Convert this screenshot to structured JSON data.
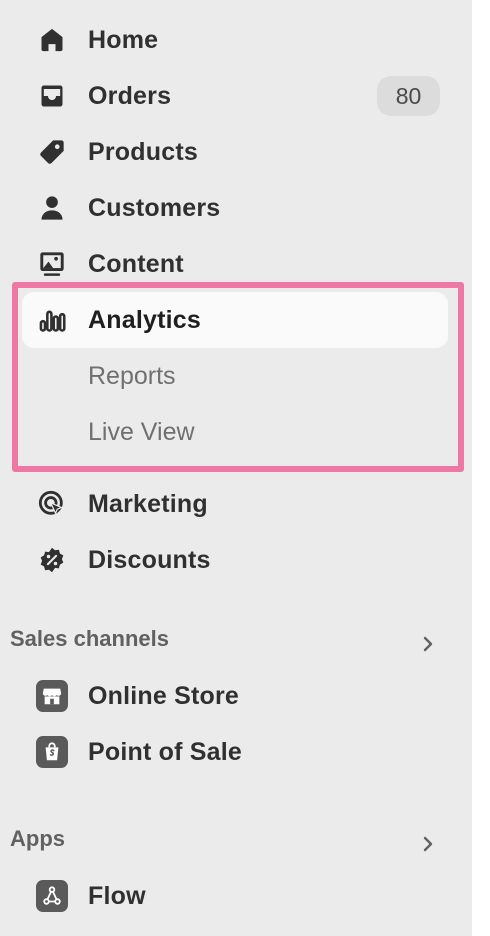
{
  "nav": {
    "home": "Home",
    "orders": "Orders",
    "orders_count": "80",
    "products": "Products",
    "customers": "Customers",
    "content": "Content",
    "analytics": "Analytics",
    "reports": "Reports",
    "live_view": "Live View",
    "marketing": "Marketing",
    "discounts": "Discounts"
  },
  "sales_channels": {
    "title": "Sales channels",
    "items": [
      "Online Store",
      "Point of Sale"
    ]
  },
  "apps": {
    "title": "Apps",
    "items": [
      "Flow"
    ]
  },
  "colors": {
    "highlight": "#ee77a3",
    "sidebar_bg": "#ebebeb",
    "active_bg": "#fafafa"
  },
  "icons": {
    "home": "home-icon",
    "orders": "inbox-icon",
    "products": "tag-icon",
    "customers": "person-icon",
    "content": "image-icon",
    "analytics": "bar-chart-icon",
    "marketing": "target-icon",
    "discounts": "discount-badge-icon",
    "online_store": "store-icon",
    "point_of_sale": "shopify-bag-icon",
    "flow": "flow-icon",
    "chevron": "chevron-right-icon"
  }
}
